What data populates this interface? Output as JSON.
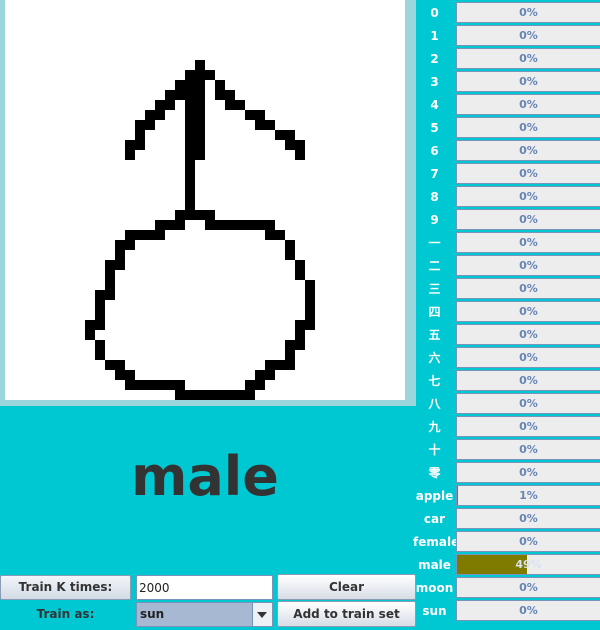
{
  "drawing": {
    "blocks": [
      [
        19,
        6
      ],
      [
        18,
        7
      ],
      [
        19,
        7
      ],
      [
        20,
        7
      ],
      [
        17,
        8
      ],
      [
        18,
        8
      ],
      [
        19,
        8
      ],
      [
        21,
        8
      ],
      [
        16,
        9
      ],
      [
        17,
        9
      ],
      [
        18,
        9
      ],
      [
        19,
        9
      ],
      [
        21,
        9
      ],
      [
        22,
        9
      ],
      [
        15,
        10
      ],
      [
        16,
        10
      ],
      [
        18,
        10
      ],
      [
        19,
        10
      ],
      [
        22,
        10
      ],
      [
        23,
        10
      ],
      [
        14,
        11
      ],
      [
        15,
        11
      ],
      [
        18,
        11
      ],
      [
        19,
        11
      ],
      [
        24,
        11
      ],
      [
        25,
        11
      ],
      [
        13,
        12
      ],
      [
        14,
        12
      ],
      [
        18,
        12
      ],
      [
        19,
        12
      ],
      [
        25,
        12
      ],
      [
        26,
        12
      ],
      [
        13,
        13
      ],
      [
        18,
        13
      ],
      [
        19,
        13
      ],
      [
        27,
        13
      ],
      [
        28,
        13
      ],
      [
        12,
        14
      ],
      [
        13,
        14
      ],
      [
        18,
        14
      ],
      [
        19,
        14
      ],
      [
        28,
        14
      ],
      [
        29,
        14
      ],
      [
        12,
        15
      ],
      [
        18,
        15
      ],
      [
        19,
        15
      ],
      [
        29,
        15
      ],
      [
        18,
        16
      ],
      [
        18,
        17
      ],
      [
        18,
        18
      ],
      [
        18,
        19
      ],
      [
        18,
        20
      ],
      [
        17,
        21
      ],
      [
        18,
        21
      ],
      [
        19,
        21
      ],
      [
        20,
        21
      ],
      [
        15,
        22
      ],
      [
        16,
        22
      ],
      [
        17,
        22
      ],
      [
        20,
        22
      ],
      [
        21,
        22
      ],
      [
        22,
        22
      ],
      [
        23,
        22
      ],
      [
        24,
        22
      ],
      [
        25,
        22
      ],
      [
        26,
        22
      ],
      [
        12,
        23
      ],
      [
        13,
        23
      ],
      [
        14,
        23
      ],
      [
        15,
        23
      ],
      [
        26,
        23
      ],
      [
        27,
        23
      ],
      [
        11,
        24
      ],
      [
        12,
        24
      ],
      [
        28,
        24
      ],
      [
        11,
        25
      ],
      [
        28,
        25
      ],
      [
        10,
        26
      ],
      [
        11,
        26
      ],
      [
        29,
        26
      ],
      [
        10,
        27
      ],
      [
        29,
        27
      ],
      [
        10,
        28
      ],
      [
        30,
        28
      ],
      [
        9,
        29
      ],
      [
        10,
        29
      ],
      [
        30,
        29
      ],
      [
        9,
        30
      ],
      [
        30,
        30
      ],
      [
        9,
        31
      ],
      [
        30,
        31
      ],
      [
        8,
        32
      ],
      [
        9,
        32
      ],
      [
        29,
        32
      ],
      [
        30,
        32
      ],
      [
        8,
        33
      ],
      [
        29,
        33
      ],
      [
        9,
        34
      ],
      [
        28,
        34
      ],
      [
        29,
        34
      ],
      [
        9,
        35
      ],
      [
        28,
        35
      ],
      [
        10,
        36
      ],
      [
        11,
        36
      ],
      [
        26,
        36
      ],
      [
        27,
        36
      ],
      [
        28,
        36
      ],
      [
        11,
        37
      ],
      [
        12,
        37
      ],
      [
        25,
        37
      ],
      [
        26,
        37
      ],
      [
        12,
        38
      ],
      [
        13,
        38
      ],
      [
        14,
        38
      ],
      [
        15,
        38
      ],
      [
        16,
        38
      ],
      [
        17,
        38
      ],
      [
        24,
        38
      ],
      [
        25,
        38
      ],
      [
        17,
        39
      ],
      [
        18,
        39
      ],
      [
        19,
        39
      ],
      [
        20,
        39
      ],
      [
        21,
        39
      ],
      [
        22,
        39
      ],
      [
        23,
        39
      ],
      [
        24,
        39
      ]
    ]
  },
  "prediction": "male",
  "results": [
    {
      "label": "0",
      "value": 0,
      "text": "0%"
    },
    {
      "label": "1",
      "value": 0,
      "text": "0%"
    },
    {
      "label": "2",
      "value": 0,
      "text": "0%"
    },
    {
      "label": "3",
      "value": 0,
      "text": "0%"
    },
    {
      "label": "4",
      "value": 0,
      "text": "0%"
    },
    {
      "label": "5",
      "value": 0,
      "text": "0%"
    },
    {
      "label": "6",
      "value": 0,
      "text": "0%"
    },
    {
      "label": "7",
      "value": 0,
      "text": "0%"
    },
    {
      "label": "8",
      "value": 0,
      "text": "0%"
    },
    {
      "label": "9",
      "value": 0,
      "text": "0%"
    },
    {
      "label": "一",
      "value": 0,
      "text": "0%"
    },
    {
      "label": "二",
      "value": 0,
      "text": "0%"
    },
    {
      "label": "三",
      "value": 0,
      "text": "0%"
    },
    {
      "label": "四",
      "value": 0,
      "text": "0%"
    },
    {
      "label": "五",
      "value": 0,
      "text": "0%"
    },
    {
      "label": "六",
      "value": 0,
      "text": "0%"
    },
    {
      "label": "七",
      "value": 0,
      "text": "0%"
    },
    {
      "label": "八",
      "value": 0,
      "text": "0%"
    },
    {
      "label": "九",
      "value": 0,
      "text": "0%"
    },
    {
      "label": "十",
      "value": 0,
      "text": "0%"
    },
    {
      "label": "零",
      "value": 0,
      "text": "0%"
    },
    {
      "label": "apple",
      "value": 0.01,
      "text": "1%"
    },
    {
      "label": "car",
      "value": 0,
      "text": "0%"
    },
    {
      "label": "female",
      "value": 0,
      "text": "0%"
    },
    {
      "label": "male",
      "value": 0.49,
      "text": "49%"
    },
    {
      "label": "moon",
      "value": 0,
      "text": "0%"
    },
    {
      "label": "sun",
      "value": 0,
      "text": "0%"
    }
  ],
  "controls": {
    "train_k_label": "Train K times:",
    "train_k_value": "2000",
    "train_as_label": "Train as:",
    "train_as_value": "sun",
    "clear_label": "Clear",
    "add_label": "Add to train set"
  },
  "colors": {
    "background": "#00c8d2",
    "bar_fill": "#7f7a00",
    "percent_text": "#6685b5"
  }
}
